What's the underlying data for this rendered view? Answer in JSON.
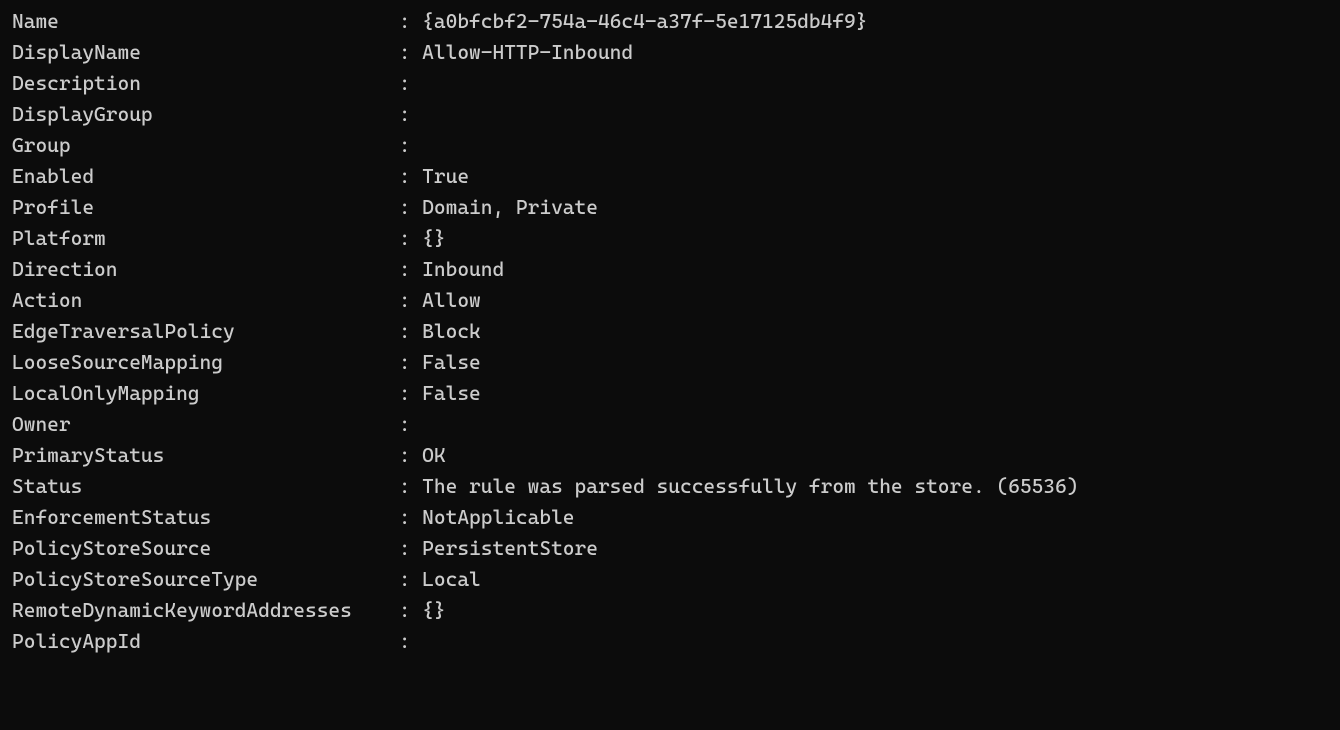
{
  "separator": ": ",
  "properties": [
    {
      "key": "Name",
      "value": "{a0bfcbf2-754a-46c4-a37f-5e17125db4f9}"
    },
    {
      "key": "DisplayName",
      "value": "Allow-HTTP-Inbound"
    },
    {
      "key": "Description",
      "value": ""
    },
    {
      "key": "DisplayGroup",
      "value": ""
    },
    {
      "key": "Group",
      "value": ""
    },
    {
      "key": "Enabled",
      "value": "True"
    },
    {
      "key": "Profile",
      "value": "Domain, Private"
    },
    {
      "key": "Platform",
      "value": "{}"
    },
    {
      "key": "Direction",
      "value": "Inbound"
    },
    {
      "key": "Action",
      "value": "Allow"
    },
    {
      "key": "EdgeTraversalPolicy",
      "value": "Block"
    },
    {
      "key": "LooseSourceMapping",
      "value": "False"
    },
    {
      "key": "LocalOnlyMapping",
      "value": "False"
    },
    {
      "key": "Owner",
      "value": ""
    },
    {
      "key": "PrimaryStatus",
      "value": "OK"
    },
    {
      "key": "Status",
      "value": "The rule was parsed successfully from the store. (65536)"
    },
    {
      "key": "EnforcementStatus",
      "value": "NotApplicable"
    },
    {
      "key": "PolicyStoreSource",
      "value": "PersistentStore"
    },
    {
      "key": "PolicyStoreSourceType",
      "value": "Local"
    },
    {
      "key": "RemoteDynamicKeywordAddresses",
      "value": "{}"
    },
    {
      "key": "PolicyAppId",
      "value": ""
    }
  ]
}
